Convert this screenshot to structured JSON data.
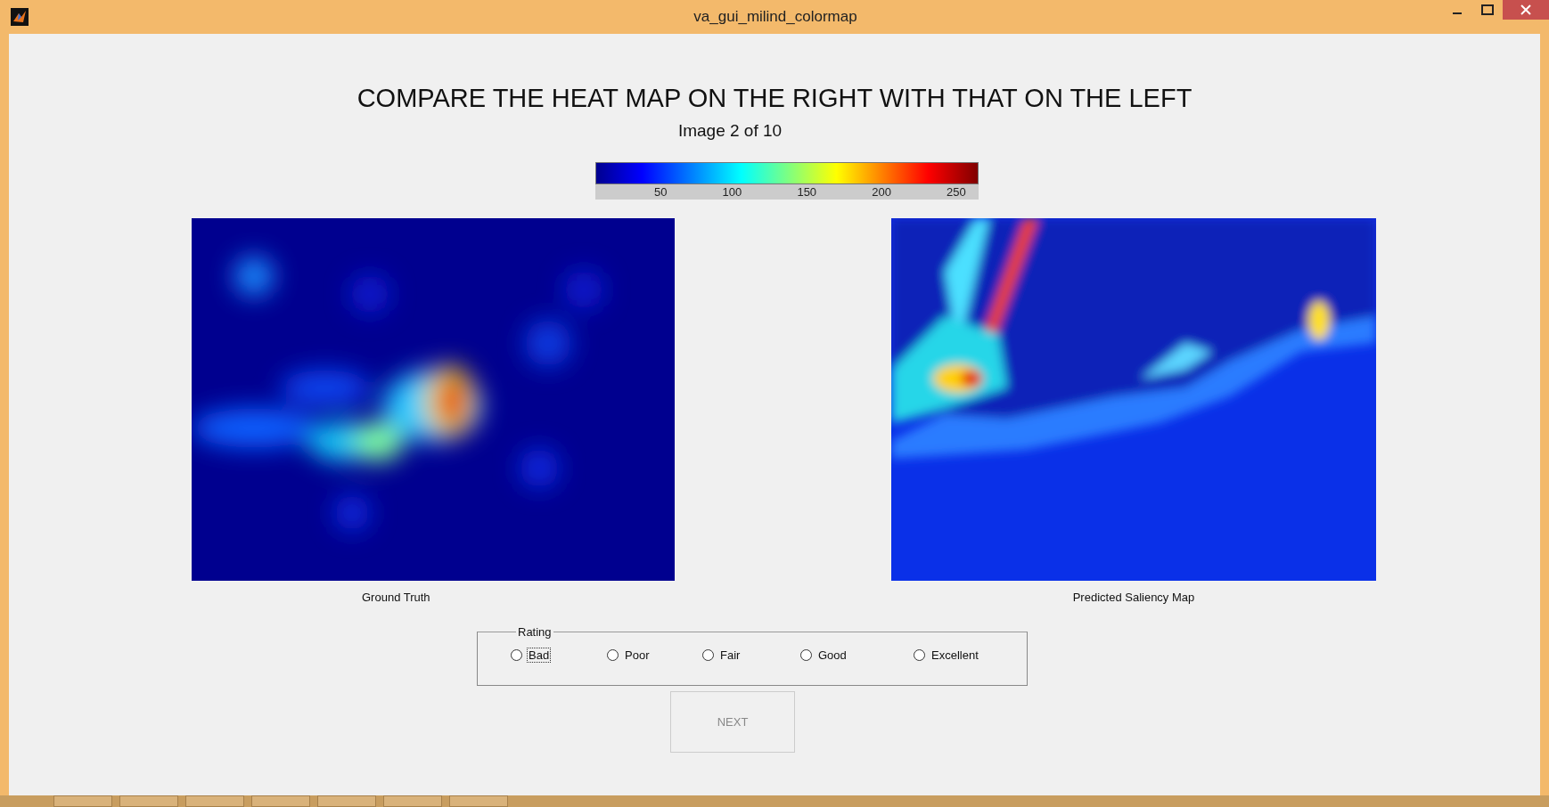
{
  "window": {
    "title": "va_gui_milind_colormap"
  },
  "heading": "COMPARE THE HEAT MAP ON THE RIGHT WITH THAT ON THE LEFT",
  "progress": "Image 2 of 10",
  "colorbar": {
    "ticks": [
      "50",
      "100",
      "150",
      "200",
      "250"
    ]
  },
  "images": [
    {
      "caption": "Ground Truth",
      "kind": "picture"
    },
    {
      "caption": "Predicted Saliency Map",
      "kind": "picture"
    }
  ],
  "rating": {
    "legend": "Rating",
    "options": [
      {
        "label": "Bad",
        "selected": false,
        "focused": true
      },
      {
        "label": "Poor",
        "selected": false,
        "focused": false
      },
      {
        "label": "Fair",
        "selected": false,
        "focused": false
      },
      {
        "label": "Good",
        "selected": false,
        "focused": false
      },
      {
        "label": "Excellent",
        "selected": false,
        "focused": false
      }
    ]
  },
  "next_button": {
    "label": "NEXT",
    "disabled": true
  }
}
